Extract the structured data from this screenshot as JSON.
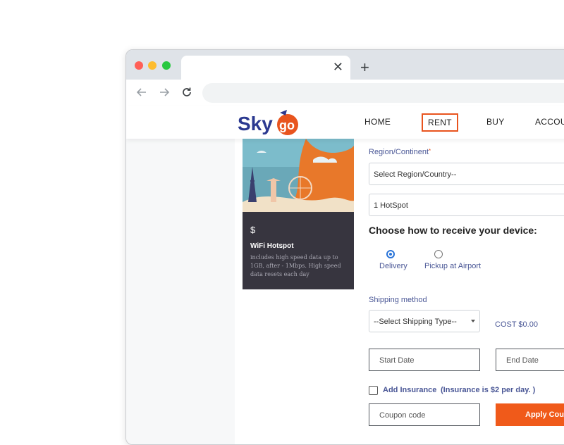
{
  "browser": {
    "tab_close_glyph": "✕",
    "new_tab_glyph": "+"
  },
  "site": {
    "logo_sky": "Sky",
    "logo_go": "go",
    "nav": {
      "home": "HOME",
      "rent": "RENT",
      "buy": "BUY",
      "account": "ACCOUNT"
    }
  },
  "product_card": {
    "price": "$",
    "title": "WiFi Hotspot",
    "description": "includes high speed data up to 1GB, after - 1Mbps. High speed data resets each day"
  },
  "form": {
    "region_label": "Region/Continent",
    "required_mark": "*",
    "region_value": "Select Region/Country--",
    "hotspot_value": "1 HotSpot",
    "receive_heading": "Choose how to receive your device:",
    "options": {
      "delivery": "Delivery",
      "pickup": "Pickup at Airport"
    },
    "selected_option": "delivery",
    "shipping_label": "Shipping method",
    "shipping_value": "--Select Shipping Type--",
    "cost": "COST $0.00",
    "start_date_placeholder": "Start Date",
    "end_date_placeholder": "End Date",
    "insurance_label": "Add Insurance",
    "insurance_note": "(Insurance is $2 per day. )",
    "coupon_placeholder": "Coupon code",
    "apply_button": "Apply Coupon"
  },
  "colors": {
    "accent": "#e8541e",
    "card_bg": "#37353f",
    "label_blue": "#4a5796",
    "radio_blue": "#2a74d8"
  }
}
